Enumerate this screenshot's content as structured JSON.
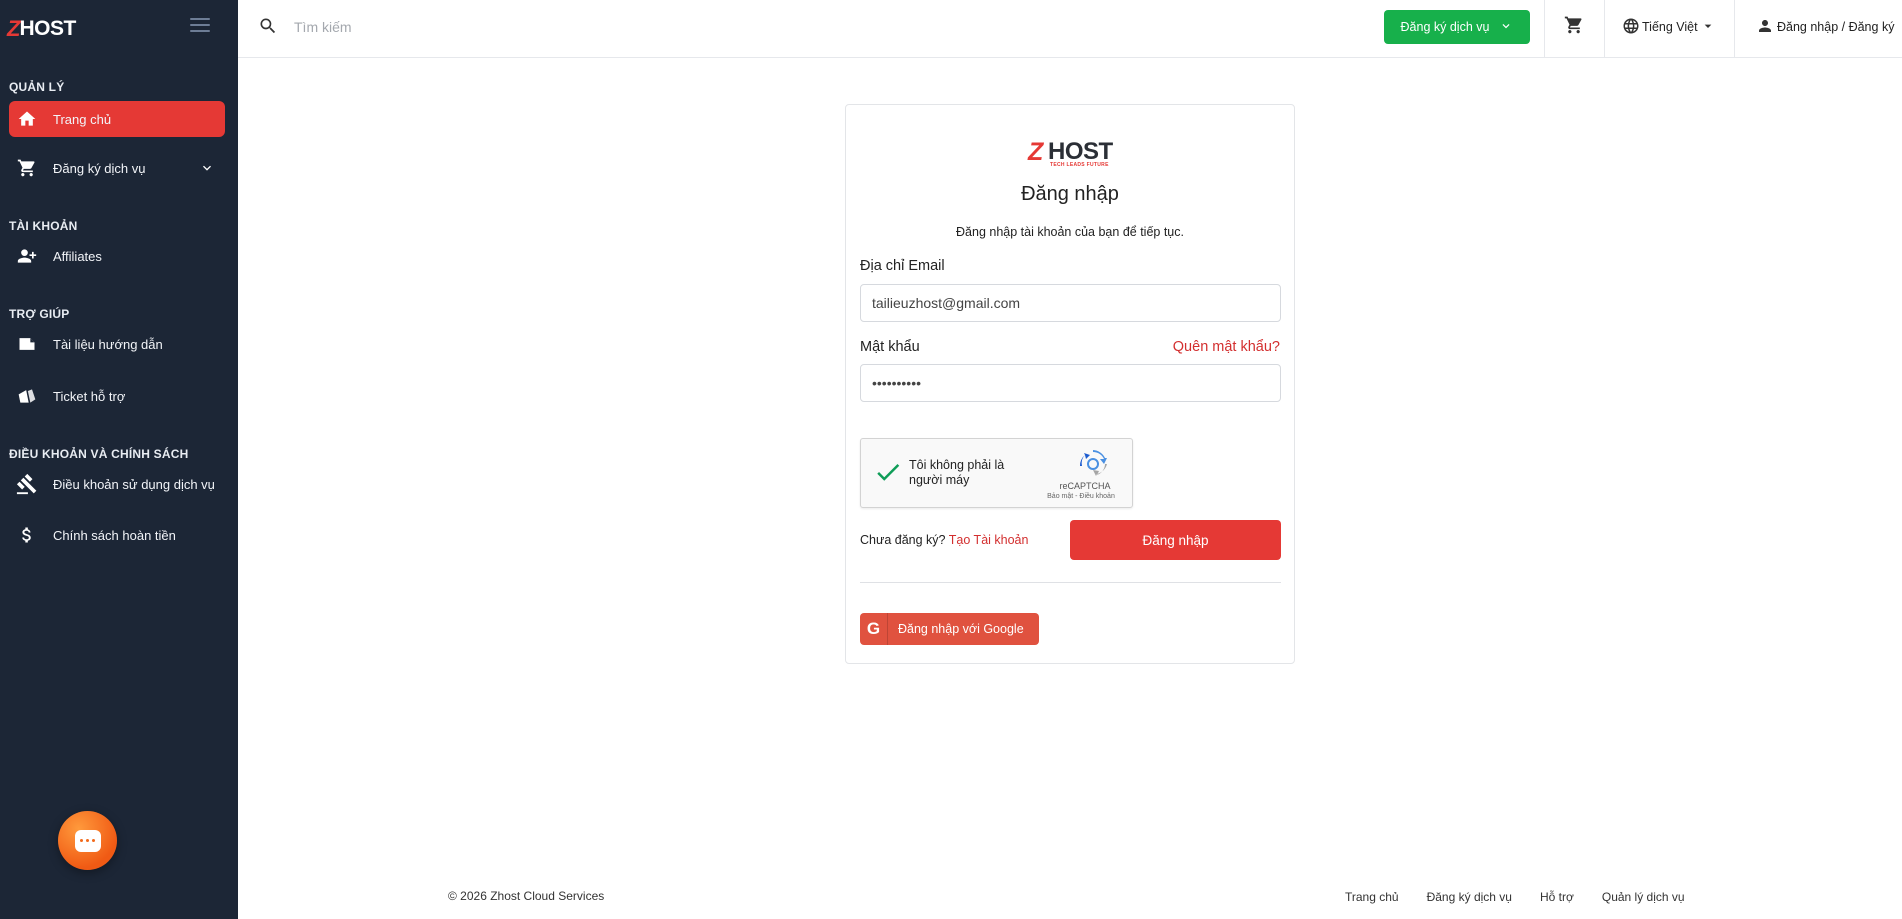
{
  "brand": {
    "z": "Z",
    "host": "HOST",
    "tagline": "TECH LEADS FUTURE"
  },
  "sidebar": {
    "sections": [
      {
        "title": "QUẢN LÝ"
      },
      {
        "title": "TÀI KHOẢN"
      },
      {
        "title": "TRỢ GIÚP"
      },
      {
        "title": "ĐIỀU KHOẢN VÀ CHÍNH SÁCH"
      }
    ],
    "items": [
      {
        "label": "Trang chủ",
        "icon": "home-icon",
        "active": true
      },
      {
        "label": "Đăng ký dịch vụ",
        "icon": "cart-icon"
      },
      {
        "label": "Affiliates",
        "icon": "add-user-icon"
      },
      {
        "label": "Tài liệu hướng dẫn",
        "icon": "document-icon"
      },
      {
        "label": "Ticket hỗ trợ",
        "icon": "ticket-icon"
      },
      {
        "label": "Điều khoản sử dụng dịch vụ",
        "icon": "gavel-icon"
      },
      {
        "label": "Chính sách hoàn tiền",
        "icon": "dollar-icon"
      }
    ]
  },
  "topbar": {
    "search_placeholder": "Tìm kiếm",
    "register_label": "Đăng ký dịch vụ",
    "language_label": "Tiếng Việt",
    "login_label": "Đăng nhập / Đăng ký"
  },
  "login": {
    "title": "Đăng nhập",
    "subtitle": "Đăng nhập tài khoản của bạn để tiếp tục.",
    "email_label": "Địa chỉ Email",
    "email_value": "tailieuzhost@gmail.com",
    "password_label": "Mật khẩu",
    "password_value": "••••••••••",
    "forgot_label": "Quên mật khẩu?",
    "captcha_text": "Tôi không phải là người máy",
    "captcha_brand": "reCAPTCHA",
    "captcha_terms": "Bảo mật - Điều khoản",
    "signup_prompt": "Chưa đăng ký?",
    "signup_link": "Tạo Tài khoản",
    "submit_label": "Đăng nhập",
    "google_label": "Đăng nhập với Google"
  },
  "footer": {
    "copyright": "© 2026 Zhost Cloud Services",
    "links": [
      "Trang chủ",
      "Đăng ký dịch vụ",
      "Hỗ trợ",
      "Quản lý dịch vụ"
    ]
  },
  "colors": {
    "sidebar_bg": "#1c2636",
    "accent_red": "#e53935",
    "register_green": "#17b04b",
    "google_red": "#e0523f",
    "chat_orange": "#f05a14"
  }
}
